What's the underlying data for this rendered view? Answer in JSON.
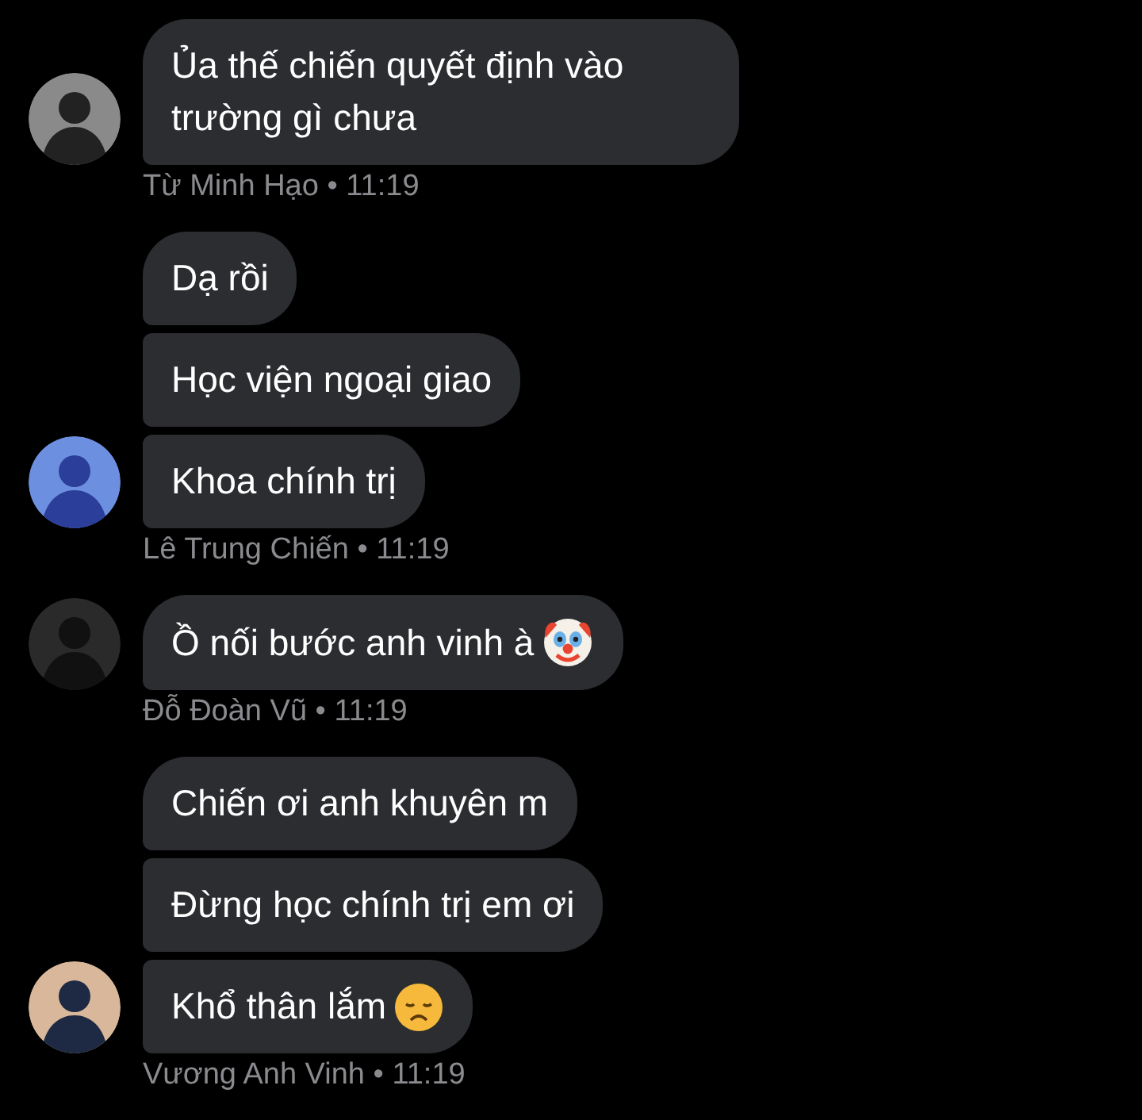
{
  "groups": [
    {
      "sender": "Từ Minh Hạo",
      "time": "11:19",
      "messages": [
        {
          "text": "Ủa thế chiến quyết định vào trường gì chưa"
        }
      ]
    },
    {
      "sender": "Lê Trung Chiến",
      "time": "11:19",
      "messages": [
        {
          "text": "Dạ rồi"
        },
        {
          "text": "Học viện ngoại giao"
        },
        {
          "text": "Khoa chính trị"
        }
      ]
    },
    {
      "sender": "Đỗ Đoàn Vũ",
      "time": "11:19",
      "messages": [
        {
          "text": "Ồ nối bước anh vinh à",
          "kind": "clown"
        }
      ]
    },
    {
      "sender": "Vương Anh Vinh",
      "time": "11:19",
      "messages": [
        {
          "text": "Chiến ơi anh khuyên m"
        },
        {
          "text": "Đừng học chính trị em ơi"
        },
        {
          "text": "Khổ thân lắm",
          "kind": "sad"
        }
      ]
    }
  ],
  "separator": "•"
}
